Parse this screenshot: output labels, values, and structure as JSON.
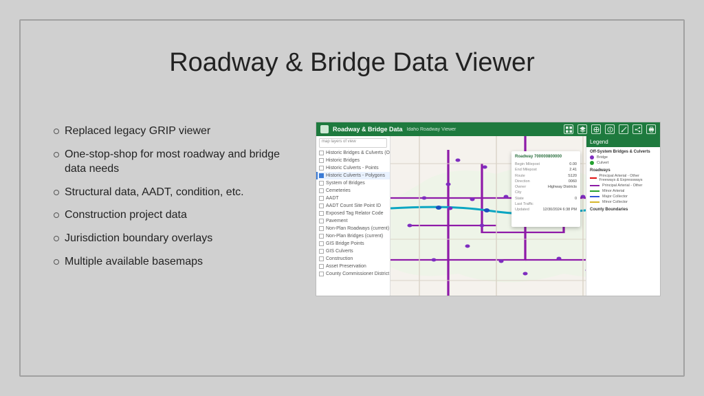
{
  "title": "Roadway & Bridge Data Viewer",
  "bullets": [
    "Replaced legacy GRIP viewer",
    "One-stop-shop for most roadway and bridge data needs",
    "Structural data, AADT, condition, etc.",
    "Construction project data",
    "Jurisdiction boundary overlays",
    "Multiple available basemaps"
  ],
  "thumb": {
    "header": {
      "title": "Roadway & Bridge Data",
      "subtitle": "Idaho Roadway Viewer"
    },
    "search_placeholder": "map layers of view",
    "layers": [
      "Historic Bridges & Culverts (On-System)",
      "Historic Bridges",
      "Historic Culverts - Points",
      "Historic Culverts - Polygons",
      "System of Bridges",
      "Cemeteries",
      "AADT",
      "AADT Count Site Point ID",
      "Exposed Tag Relator Code",
      "Pavement",
      "Non-Plan Roadways (current)",
      "Non-Plan Bridges (current)",
      "GIS Bridge Points",
      "GIS Culverts",
      "Construction",
      "Asset Preservation",
      "County Commissioner District"
    ],
    "popup": {
      "title": "Roadway 700000800000",
      "rows": [
        [
          "Begin Milepost",
          "0.00"
        ],
        [
          "End Milepost",
          "2.41"
        ],
        [
          "Route",
          "S120"
        ],
        [
          "Direction",
          "0060"
        ],
        [
          "Owner",
          "Highway Districts"
        ],
        [
          "City",
          ""
        ],
        [
          "State",
          "0"
        ],
        [
          "Last Traffic",
          ""
        ],
        [
          "Updated",
          "12/30/2024 6:38 PM"
        ]
      ]
    },
    "legend": {
      "title": "Legend",
      "section1": "Off-System Bridges & Culverts",
      "dots": [
        {
          "label": "Bridge",
          "color": "#7e2dbf"
        },
        {
          "label": "Culvert",
          "color": "#23a02e"
        }
      ],
      "section2": "Roadways",
      "lines": [
        {
          "label": "Principal Arterial - Other Freeways & Expressways",
          "color": "#e01010"
        },
        {
          "label": "Principal Arterial - Other",
          "color": "#8c1aa6"
        },
        {
          "label": "Minor Arterial",
          "color": "#24a12e"
        },
        {
          "label": "Major Collector",
          "color": "#2d55d6"
        },
        {
          "label": "Minor Collector",
          "color": "#d6b62a"
        }
      ],
      "section3": "County Boundaries"
    }
  }
}
